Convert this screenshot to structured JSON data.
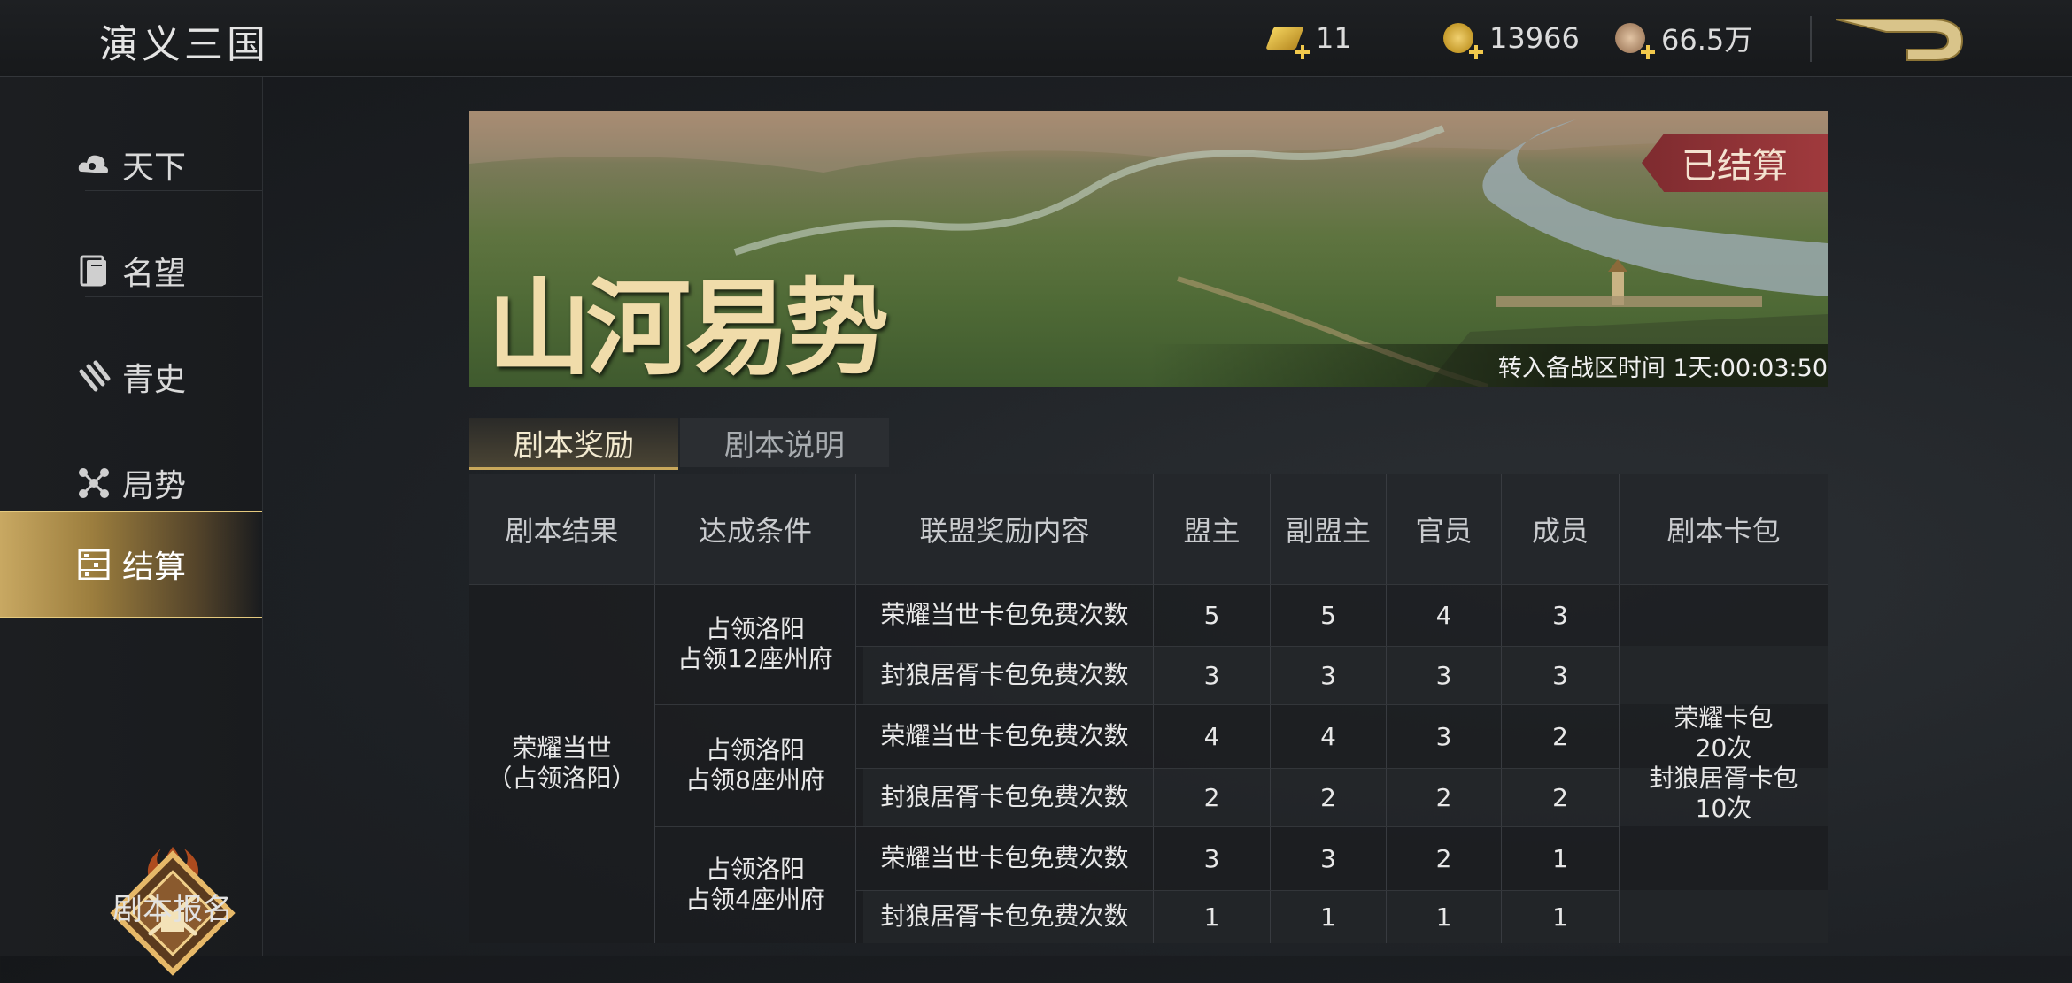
{
  "header": {
    "title": "演义三国",
    "resources": [
      {
        "icon": "gold-ticket-icon",
        "value": "11"
      },
      {
        "icon": "gold-coin-icon",
        "value": "13966"
      },
      {
        "icon": "copper-coin-icon",
        "value": "66.5万"
      }
    ]
  },
  "sidebar": {
    "items": [
      {
        "label": "天下",
        "icon": "cloud-icon",
        "active": false
      },
      {
        "label": "名望",
        "icon": "book-icon",
        "active": false
      },
      {
        "label": "青史",
        "icon": "scroll-icon",
        "active": false
      },
      {
        "label": "局势",
        "icon": "network-icon",
        "active": false
      },
      {
        "label": "结算",
        "icon": "abacus-icon",
        "active": true
      }
    ],
    "enroll_label": "剧本报名"
  },
  "banner": {
    "title": "山河易势",
    "badge": "已结算",
    "countdown": "转入备战区时间 1天:00:03:50"
  },
  "tabs": [
    {
      "label": "剧本奖励",
      "active": true
    },
    {
      "label": "剧本说明",
      "active": false
    }
  ],
  "table": {
    "headers": [
      "剧本结果",
      "达成条件",
      "联盟奖励内容",
      "盟主",
      "副盟主",
      "官员",
      "成员",
      "剧本卡包"
    ],
    "result": "荣耀当世\n（占领洛阳）",
    "card_pack": "荣耀卡包\n20次\n封狼居胥卡包\n10次",
    "groups": [
      {
        "condition": "占领洛阳\n占领12座州府",
        "rows": [
          {
            "reward": "荣耀当世卡包免费次数",
            "values": [
              "5",
              "5",
              "4",
              "3"
            ]
          },
          {
            "reward": "封狼居胥卡包免费次数",
            "values": [
              "3",
              "3",
              "3",
              "3"
            ]
          }
        ]
      },
      {
        "condition": "占领洛阳\n占领8座州府",
        "rows": [
          {
            "reward": "荣耀当世卡包免费次数",
            "values": [
              "4",
              "4",
              "3",
              "2"
            ]
          },
          {
            "reward": "封狼居胥卡包免费次数",
            "values": [
              "2",
              "2",
              "2",
              "2"
            ]
          }
        ]
      },
      {
        "condition": "占领洛阳\n占领4座州府",
        "rows": [
          {
            "reward": "荣耀当世卡包免费次数",
            "values": [
              "3",
              "3",
              "2",
              "1"
            ]
          },
          {
            "reward": "封狼居胥卡包免费次数",
            "values": [
              "1",
              "1",
              "1",
              "1"
            ]
          }
        ]
      }
    ]
  }
}
